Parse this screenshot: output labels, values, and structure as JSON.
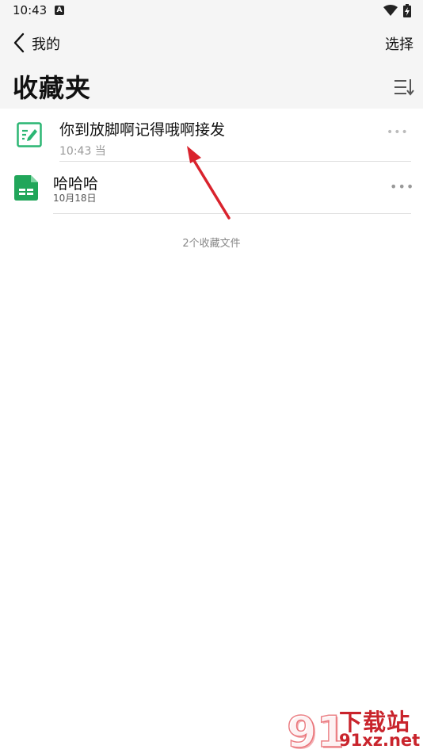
{
  "status_bar": {
    "time": "10:43",
    "notification_icon": "android-a-icon",
    "wifi_icon": "wifi-icon",
    "battery_icon": "battery-charging-icon"
  },
  "nav": {
    "back_label": "我的",
    "select_label": "选择"
  },
  "page": {
    "title": "收藏夹"
  },
  "files": [
    {
      "name": "你到放脚啊记得哦啊接发",
      "meta": "10:43 当",
      "type_icon": "note-edit-icon",
      "color": "#2bb673"
    },
    {
      "name": "哈哈哈",
      "meta": "10月18日",
      "type_icon": "spreadsheet-icon",
      "color": "#21a65a"
    }
  ],
  "footer": {
    "count_text": "2个收藏文件"
  },
  "annotation": {
    "arrow_color": "#d9232d"
  },
  "watermark": {
    "name": "下载站",
    "url": "91xz.net",
    "brand_color": "#c9242c"
  }
}
